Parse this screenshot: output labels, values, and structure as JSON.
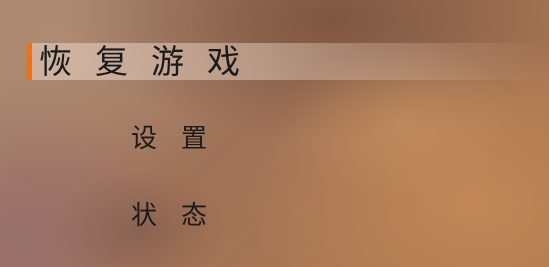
{
  "menu": {
    "items": [
      {
        "label": "恢复游戏",
        "selected": true
      },
      {
        "label": "设置",
        "selected": false
      },
      {
        "label": "状态",
        "selected": false
      }
    ],
    "accent_color": "#f0701a"
  }
}
